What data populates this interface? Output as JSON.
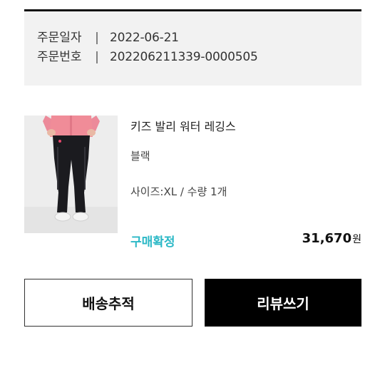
{
  "order": {
    "date_label": "주문일자",
    "separator": "|",
    "date_value": "2022-06-21",
    "number_label": "주문번호",
    "number_value": "202206211339-0000505"
  },
  "product": {
    "name": "키즈 발리 워터 레깅스",
    "color": "블랙",
    "option": "사이즈:XL / 수량 1개",
    "status": "구매확정",
    "price": "31,670",
    "currency": "원"
  },
  "actions": {
    "track_label": "배송추적",
    "review_label": "리뷰쓰기"
  },
  "colors": {
    "status_accent": "#2bb8c6",
    "primary_button": "#000000",
    "info_background": "#f2f2f2"
  }
}
